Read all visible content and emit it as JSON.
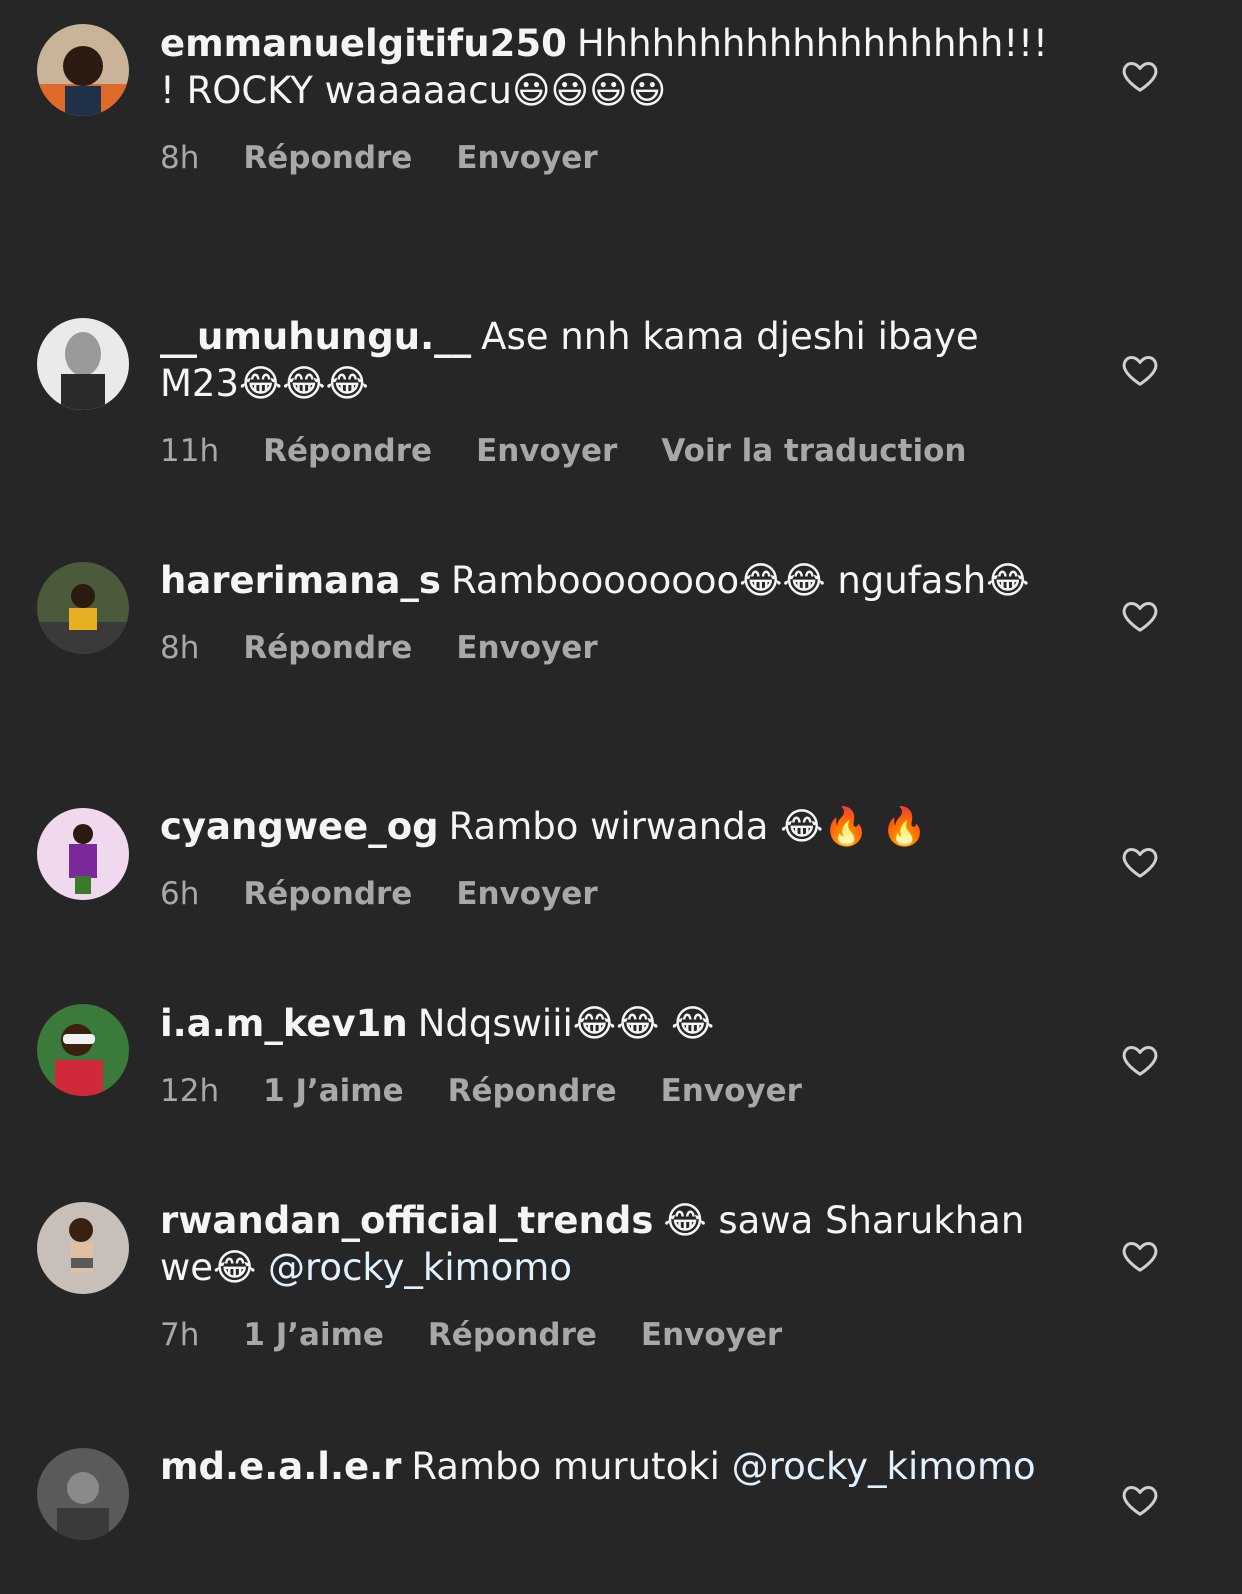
{
  "colors": {
    "background": "#262626",
    "text": "#f5f5f5",
    "meta": "#a8a8a8",
    "mention": "#e0f1ff"
  },
  "labels": {
    "reply": "Répondre",
    "send": "Envoyer",
    "translate": "Voir la traduction"
  },
  "comments": [
    {
      "username": "emmanuelgitifu250",
      "text": "Hhhhhhhhhhhhhhhhhh!!!! ROCKY waaaaacu😃😃😃😃",
      "time": "8h",
      "likes": "",
      "avatar_icon": "person-avatar-icon"
    },
    {
      "username": "__umuhungu.__",
      "text": "Ase nnh kama djeshi ibaye M23😂😂😂",
      "time": "11h",
      "likes": "",
      "avatar_icon": "statue-avatar-icon"
    },
    {
      "username": "harerimana_s",
      "text": "Ramboooooooo😂😂 ngufash😂",
      "time": "8h",
      "likes": "",
      "avatar_icon": "person-avatar-icon"
    },
    {
      "username": "cyangwee_og",
      "text": "Rambo wirwanda 😂🔥 🔥",
      "time": "6h",
      "likes": "",
      "avatar_icon": "person-avatar-icon"
    },
    {
      "username": "i.a.m_kev1n",
      "text": "Ndqswiii😂😂  😂",
      "time": "12h",
      "likes": "1 J’aime",
      "avatar_icon": "person-avatar-icon"
    },
    {
      "username": "rwandan_official_trends",
      "text": "😂 sawa Sharukhan we😂 ",
      "mention": "@rocky_kimomo",
      "time": "7h",
      "likes": "1 J’aime",
      "avatar_icon": "person-avatar-icon"
    },
    {
      "username": "md.e.a.l.e.r",
      "text": "Rambo murutoki ",
      "mention": "@rocky_kimomo",
      "time": "",
      "likes": "",
      "avatar_icon": "person-avatar-icon"
    }
  ]
}
